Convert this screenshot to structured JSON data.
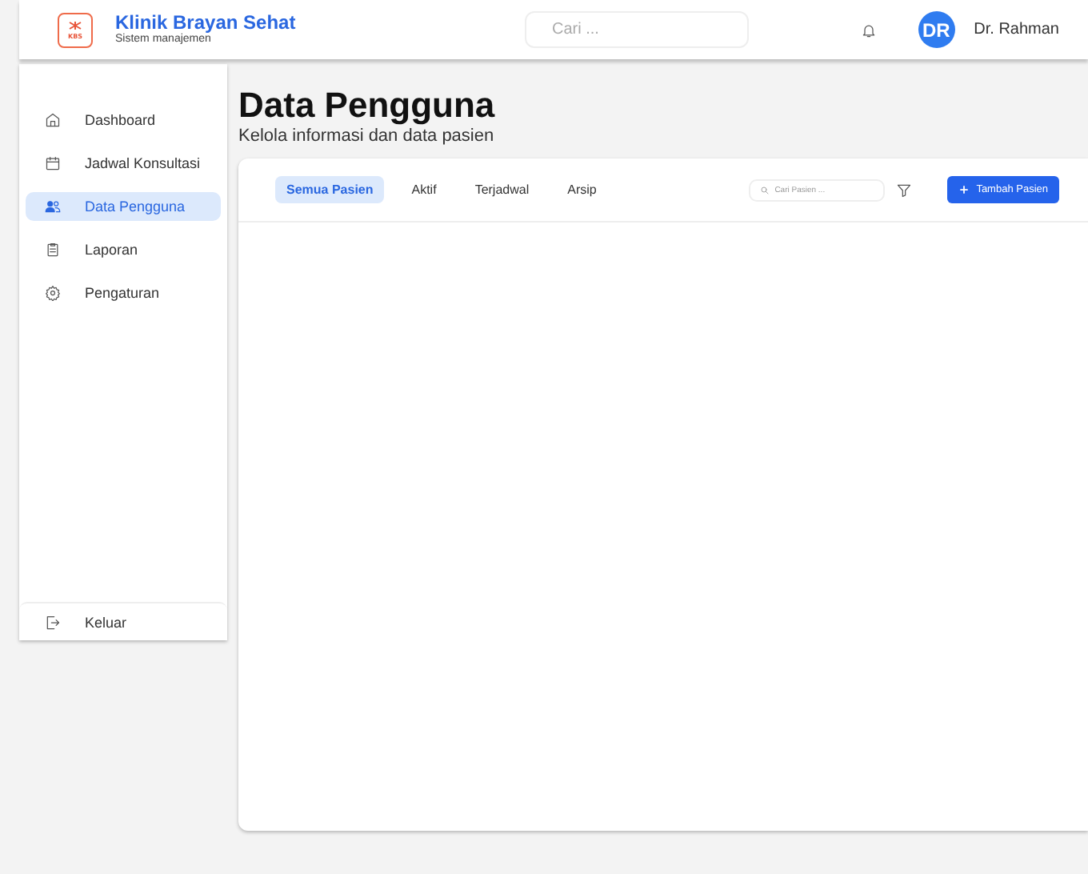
{
  "header": {
    "logo_text": "KBS",
    "brand": "Klinik Brayan Sehat",
    "subtitle": "Sistem manajemen",
    "search": {
      "placeholder": "Cari ..."
    },
    "avatar": "DR",
    "user": "Dr. Rahman"
  },
  "sidebar": {
    "items": [
      {
        "label": "Dashboard",
        "selected": false
      },
      {
        "label": "Jadwal Konsultasi",
        "selected": false
      },
      {
        "label": "Data Pengguna",
        "selected": true
      },
      {
        "label": "Laporan",
        "selected": false
      },
      {
        "label": "Pengaturan",
        "selected": false
      }
    ],
    "logout": "Keluar"
  },
  "page": {
    "title": "Data Pengguna",
    "subtitle": "Kelola informasi dan data pasien"
  },
  "tabs": [
    {
      "label": "Semua Pasien",
      "selected": true
    },
    {
      "label": "Aktif",
      "selected": false
    },
    {
      "label": "Terjadwal",
      "selected": false
    },
    {
      "label": "Arsip",
      "selected": false
    }
  ],
  "toolbar": {
    "search": {
      "placeholder": "Cari Pasien ..."
    },
    "add_button": "Tambah Pasien"
  }
}
